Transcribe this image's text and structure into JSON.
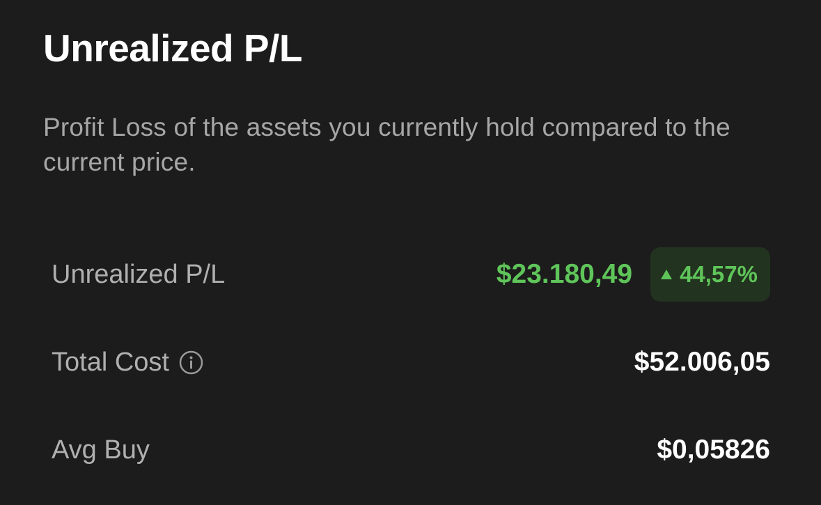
{
  "header": {
    "title": "Unrealized P/L",
    "description": "Profit Loss of the assets you currently hold compared to the current price."
  },
  "rows": [
    {
      "label": "Unrealized P/L",
      "value": "$23.180,49",
      "change_percent": "44,57%",
      "trend": "up"
    },
    {
      "label": "Total Cost",
      "value": "$52.006,05",
      "icon": "info-icon"
    },
    {
      "label": "Avg Buy",
      "value": "$0,05826"
    }
  ],
  "colors": {
    "background": "#1c1c1c",
    "positive": "#5fc55a",
    "positive_badge_bg": "#22331f",
    "label": "#b0b0b0",
    "description": "#a7a7a7"
  }
}
